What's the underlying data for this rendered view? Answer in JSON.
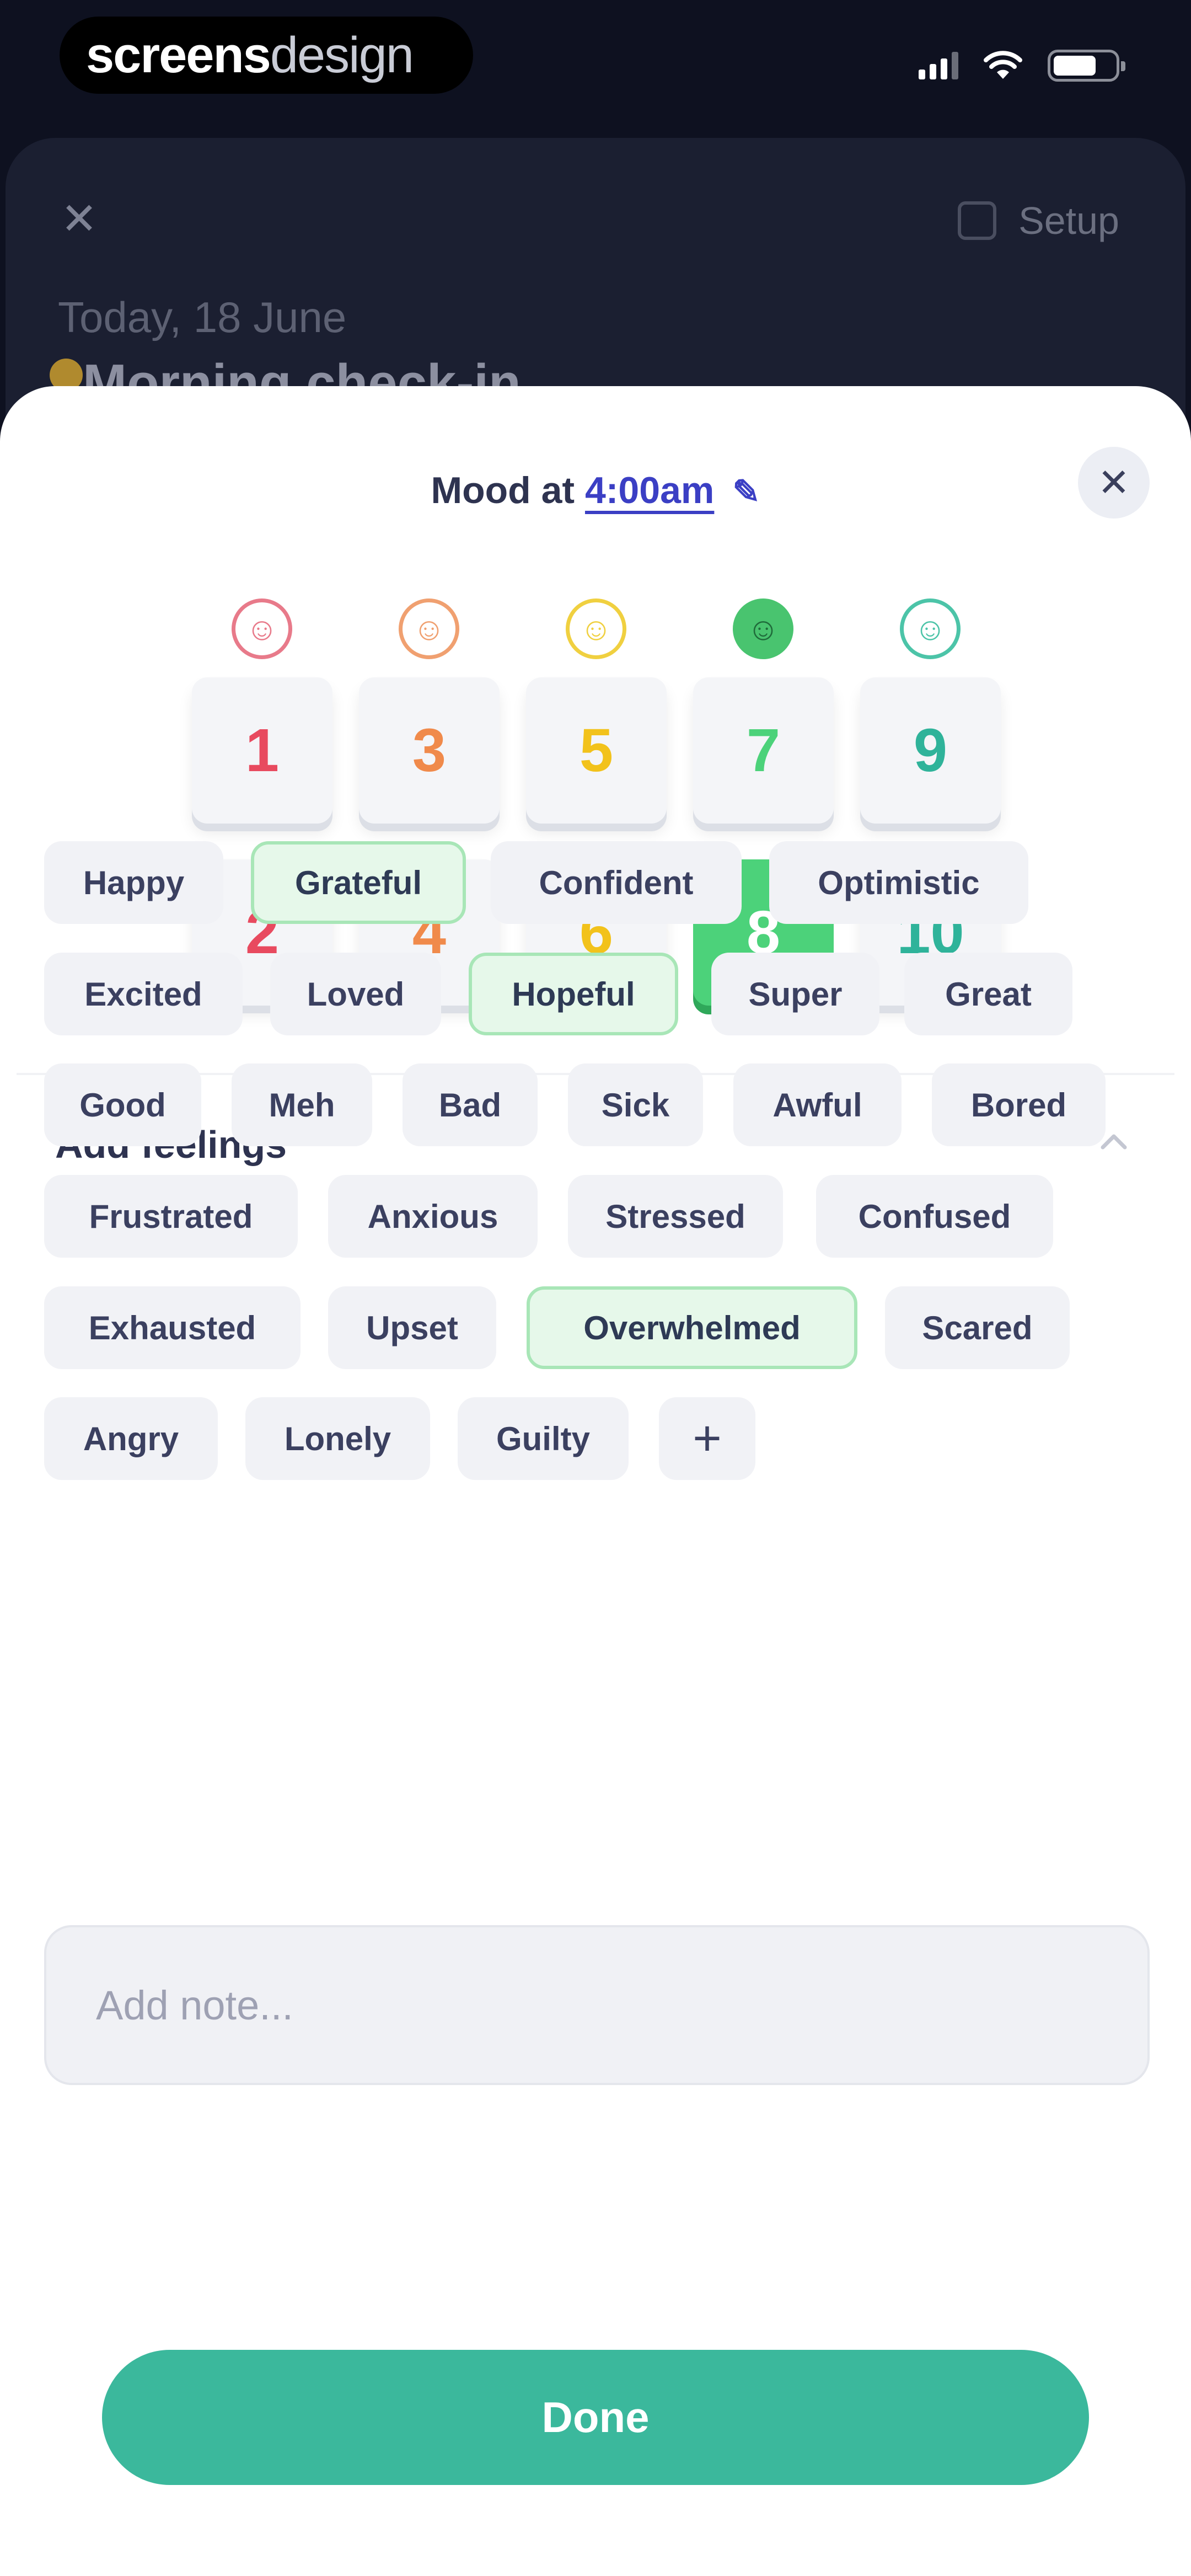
{
  "status_bar": {
    "brand_part1": "screens",
    "brand_part2": "design",
    "icons": [
      "signal-icon",
      "wifi-icon",
      "battery-icon"
    ]
  },
  "background": {
    "setup_label": "Setup",
    "date": "Today, 18 June",
    "title": "Morning check-in"
  },
  "modal": {
    "title_prefix": "Mood at",
    "time": "4:00am",
    "mood_faces": [
      {
        "color": "#e87a8a"
      },
      {
        "color": "#f0a070"
      },
      {
        "color": "#f0d040"
      },
      {
        "color": "#49c46f"
      },
      {
        "color": "#4cc4a8"
      }
    ],
    "scores_top": [
      {
        "label": "1",
        "color": "#e84a5f",
        "selected": false
      },
      {
        "label": "3",
        "color": "#f08a4b",
        "selected": false
      },
      {
        "label": "5",
        "color": "#f2c21b",
        "selected": false
      },
      {
        "label": "7",
        "color": "#4cd27a",
        "selected": false
      },
      {
        "label": "9",
        "color": "#2fb39a",
        "selected": false
      }
    ],
    "scores_bottom": [
      {
        "label": "2",
        "color": "#e84a5f",
        "selected": false
      },
      {
        "label": "4",
        "color": "#f08a4b",
        "selected": false
      },
      {
        "label": "6",
        "color": "#f2c21b",
        "selected": false
      },
      {
        "label": "8",
        "color": "#ffffff",
        "selected": true
      },
      {
        "label": "10",
        "color": "#2fb39a",
        "selected": false
      }
    ],
    "feelings_heading": "Add feelings",
    "feelings": [
      {
        "label": "Happy",
        "selected": false
      },
      {
        "label": "Grateful",
        "selected": true
      },
      {
        "label": "Confident",
        "selected": false
      },
      {
        "label": "Optimistic",
        "selected": false
      },
      {
        "label": "Excited",
        "selected": false
      },
      {
        "label": "Loved",
        "selected": false
      },
      {
        "label": "Hopeful",
        "selected": true
      },
      {
        "label": "Super",
        "selected": false
      },
      {
        "label": "Great",
        "selected": false
      },
      {
        "label": "Good",
        "selected": false
      },
      {
        "label": "Meh",
        "selected": false
      },
      {
        "label": "Bad",
        "selected": false
      },
      {
        "label": "Sick",
        "selected": false
      },
      {
        "label": "Awful",
        "selected": false
      },
      {
        "label": "Bored",
        "selected": false
      },
      {
        "label": "Frustrated",
        "selected": false
      },
      {
        "label": "Anxious",
        "selected": false
      },
      {
        "label": "Stressed",
        "selected": false
      },
      {
        "label": "Confused",
        "selected": false
      },
      {
        "label": "Exhausted",
        "selected": false
      },
      {
        "label": "Upset",
        "selected": false
      },
      {
        "label": "Overwhelmed",
        "selected": true
      },
      {
        "label": "Scared",
        "selected": false
      },
      {
        "label": "Angry",
        "selected": false
      },
      {
        "label": "Lonely",
        "selected": false
      },
      {
        "label": "Guilty",
        "selected": false
      },
      {
        "label": "+",
        "selected": false
      }
    ],
    "note_placeholder": "Add note...",
    "done_label": "Done"
  }
}
